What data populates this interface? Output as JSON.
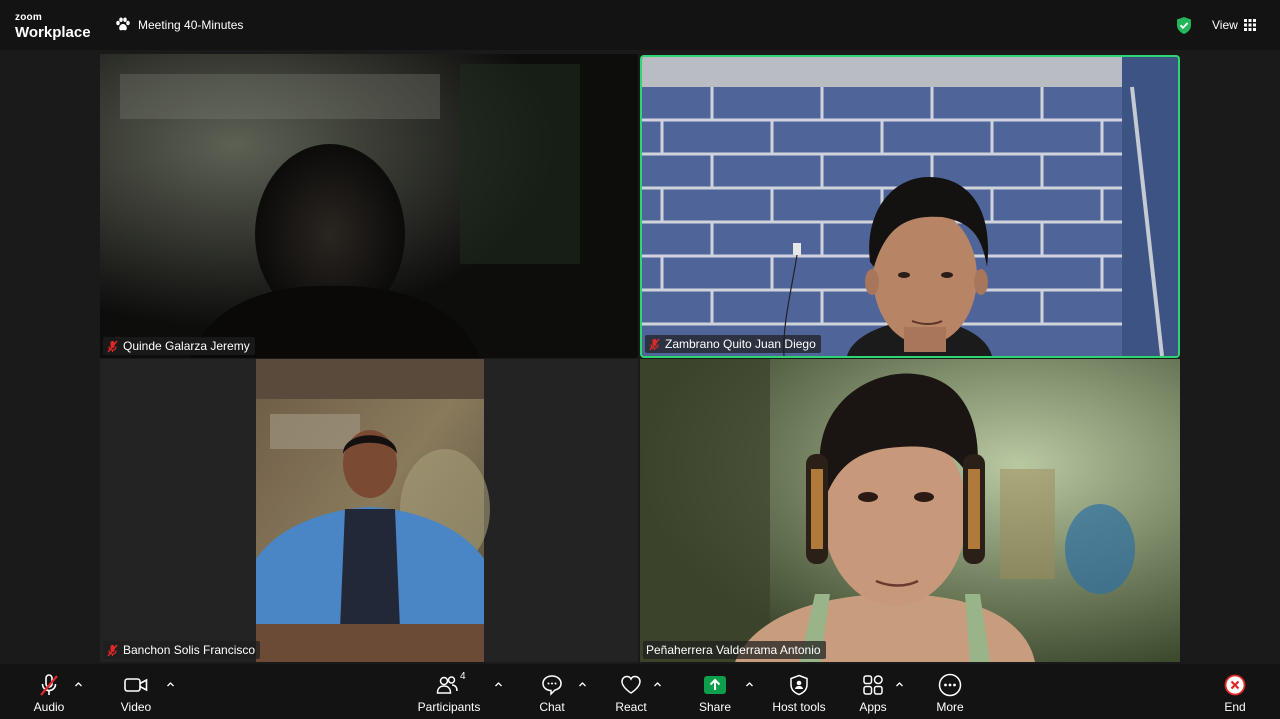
{
  "app": {
    "brand_top": "zoom",
    "brand_bottom": "Workplace"
  },
  "meeting": {
    "title": "Meeting 40-Minutes"
  },
  "header": {
    "view_label": "View"
  },
  "participants": [
    {
      "name": "Quinde Galarza Jeremy",
      "muted": true
    },
    {
      "name": "Zambrano Quito Juan Diego",
      "muted": true,
      "active_speaker": true
    },
    {
      "name": "Banchon Solis Francisco",
      "muted": true
    },
    {
      "name": "Peñaherrera Valderrama Antonio",
      "muted": false
    }
  ],
  "toolbar": {
    "audio": "Audio",
    "video": "Video",
    "participants": "Participants",
    "participant_count": "4",
    "chat": "Chat",
    "react": "React",
    "share": "Share",
    "host_tools": "Host tools",
    "apps": "Apps",
    "more": "More",
    "end": "End"
  },
  "colors": {
    "active_border": "#2ed673",
    "share_green": "#0e9f4c",
    "end_red": "#e02828",
    "mute_red": "#e02828"
  }
}
